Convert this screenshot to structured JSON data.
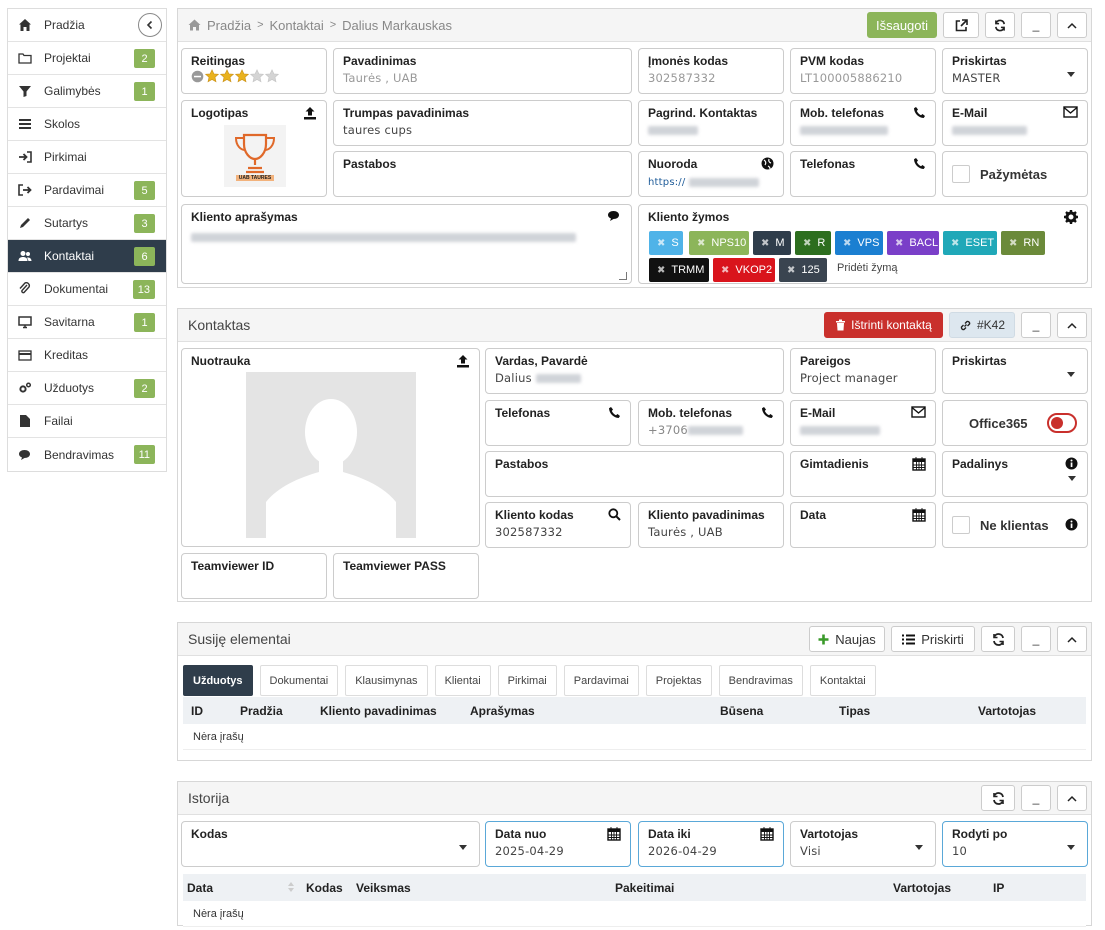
{
  "sidebar": {
    "items": [
      {
        "label": "Pradžia",
        "icon": "home-icon",
        "badge": null
      },
      {
        "label": "Projektai",
        "icon": "folder-icon",
        "badge": "2"
      },
      {
        "label": "Galimybės",
        "icon": "filter-icon",
        "badge": "1"
      },
      {
        "label": "Skolos",
        "icon": "list-icon",
        "badge": null
      },
      {
        "label": "Pirkimai",
        "icon": "sign-in-icon",
        "badge": null
      },
      {
        "label": "Pardavimai",
        "icon": "sign-out-icon",
        "badge": "5"
      },
      {
        "label": "Sutartys",
        "icon": "pencil-icon",
        "badge": "3"
      },
      {
        "label": "Kontaktai",
        "icon": "users-icon",
        "badge": "6"
      },
      {
        "label": "Dokumentai",
        "icon": "paperclip-icon",
        "badge": "13"
      },
      {
        "label": "Savitarna",
        "icon": "desktop-icon",
        "badge": "1"
      },
      {
        "label": "Kreditas",
        "icon": "credit-card-icon",
        "badge": null
      },
      {
        "label": "Užduotys",
        "icon": "cogs-icon",
        "badge": "2"
      },
      {
        "label": "Failai",
        "icon": "file-icon",
        "badge": null
      },
      {
        "label": "Bendravimas",
        "icon": "comments-icon",
        "badge": "11"
      }
    ]
  },
  "company": {
    "breadcrumb": {
      "home": "Pradžia",
      "sep1": ">",
      "contacts": "Kontaktai",
      "sep2": ">",
      "current": "Dalius Markauskas"
    },
    "save_label": "Išsaugoti",
    "minimize_label": "_",
    "rating_label": "Reitingas",
    "rating_value": 3,
    "rating_max": 5,
    "name_label": "Pavadinimas",
    "name_value": "Taurės , UAB",
    "code_label": "Įmonės kodas",
    "code_value": "302587332",
    "vat_label": "PVM kodas",
    "vat_value": "LT100005886210",
    "assigned_label": "Priskirtas",
    "assigned_value": "MASTER",
    "logo_label": "Logotipas",
    "logo_caption": "UAB TAURES",
    "short_name_label": "Trumpas pavadinimas",
    "short_name_value": "taures cups",
    "main_contact_label": "Pagrind. Kontaktas",
    "mobile_label": "Mob. telefonas",
    "email_label": "E-Mail",
    "notes_label": "Pastabos",
    "link_label": "Nuoroda",
    "link_value": "https://",
    "phone_label": "Telefonas",
    "marked_label": "Pažymėtas",
    "description_label": "Kliento aprašymas",
    "tags_label": "Kliento žymos",
    "tags": [
      {
        "text": "S",
        "color": "#4fb3e8"
      },
      {
        "text": "NPS10",
        "color": "#8cb55a"
      },
      {
        "text": "M",
        "color": "#2f3d4b"
      },
      {
        "text": "R",
        "color": "#2d6e1f"
      },
      {
        "text": "VPS",
        "color": "#1b7fd1"
      },
      {
        "text": "BACL",
        "color": "#7a3fc8"
      },
      {
        "text": "ESET",
        "color": "#20a8b8"
      },
      {
        "text": "RN",
        "color": "#6b8a3a"
      },
      {
        "text": "TRMM",
        "color": "#111111"
      },
      {
        "text": "VKOP2",
        "color": "#d9141c"
      },
      {
        "text": "125",
        "color": "#3a4450"
      }
    ],
    "add_tag_label": "Pridėti žymą"
  },
  "contact": {
    "title": "Kontaktas",
    "delete_label": "Ištrinti kontaktą",
    "ref_label": "#K42",
    "minimize_label": "_",
    "photo_label": "Nuotrauka",
    "name_label": "Vardas, Pavardė",
    "name_value": "Dalius",
    "position_label": "Pareigos",
    "position_value": "Project manager",
    "assigned_label": "Priskirtas",
    "phone_label": "Telefonas",
    "mobile_label": "Mob. telefonas",
    "mobile_value": "+3706",
    "email_label": "E-Mail",
    "office365_label": "Office365",
    "notes_label": "Pastabos",
    "birthday_label": "Gimtadienis",
    "division_label": "Padalinys",
    "client_code_label": "Kliento kodas",
    "client_code_value": "302587332",
    "client_name_label": "Kliento pavadinimas",
    "client_name_value": "Taurės , UAB",
    "date_label": "Data",
    "not_client_label": "Ne klientas",
    "teamviewer_id_label": "Teamviewer ID",
    "teamviewer_pass_label": "Teamviewer PASS"
  },
  "related": {
    "title": "Susiję elementai",
    "new_label": "Naujas",
    "assign_label": "Priskirti",
    "minimize_label": "_",
    "tabs": [
      "Užduotys",
      "Dokumentai",
      "Klausimynas",
      "Klientai",
      "Pirkimai",
      "Pardavimai",
      "Projektas",
      "Bendravimas",
      "Kontaktai"
    ],
    "columns": [
      "ID",
      "Pradžia",
      "Kliento pavadinimas",
      "Aprašymas",
      "Būsena",
      "Tipas",
      "Vartotojas"
    ],
    "empty": "Nėra įrašų"
  },
  "history": {
    "title": "Istorija",
    "minimize_label": "_",
    "code_label": "Kodas",
    "date_from_label": "Data nuo",
    "date_from_value": "2025-04-29",
    "date_to_label": "Data iki",
    "date_to_value": "2026-04-29",
    "user_label": "Vartotojas",
    "user_value": "Visi",
    "show_label": "Rodyti po",
    "show_value": "10",
    "columns": [
      "Data",
      "Kodas",
      "Veiksmas",
      "Pakeitimai",
      "Vartotojas",
      "IP"
    ],
    "empty": "Nėra įrašų"
  }
}
